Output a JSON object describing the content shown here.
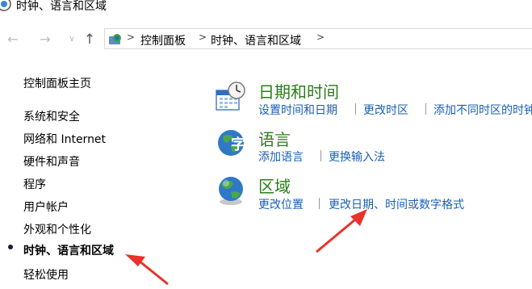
{
  "window": {
    "title": "时钟、语言和区域"
  },
  "address_bar": {
    "breadcrumbs": [
      "控制面板",
      "时钟、语言和区域"
    ]
  },
  "sidebar": {
    "items": [
      {
        "label": "控制面板主页"
      },
      {
        "label": "系统和安全"
      },
      {
        "label": "网络和 Internet"
      },
      {
        "label": "硬件和声音"
      },
      {
        "label": "程序"
      },
      {
        "label": "用户帐户"
      },
      {
        "label": "外观和个性化"
      },
      {
        "label": "时钟、语言和区域",
        "active": true
      },
      {
        "label": "轻松使用"
      }
    ]
  },
  "categories": [
    {
      "title": "日期和时间",
      "links": [
        "设置时间和日期",
        "更改时区",
        "添加不同时区的时钟"
      ]
    },
    {
      "title": "语言",
      "links": [
        "添加语言",
        "更换输入法"
      ]
    },
    {
      "title": "区域",
      "links": [
        "更改位置",
        "更改日期、时间或数字格式"
      ]
    }
  ],
  "colors": {
    "category_title": "#2b7d1a",
    "link": "#1a5fb4",
    "annotation_arrow": "#e8322a"
  }
}
